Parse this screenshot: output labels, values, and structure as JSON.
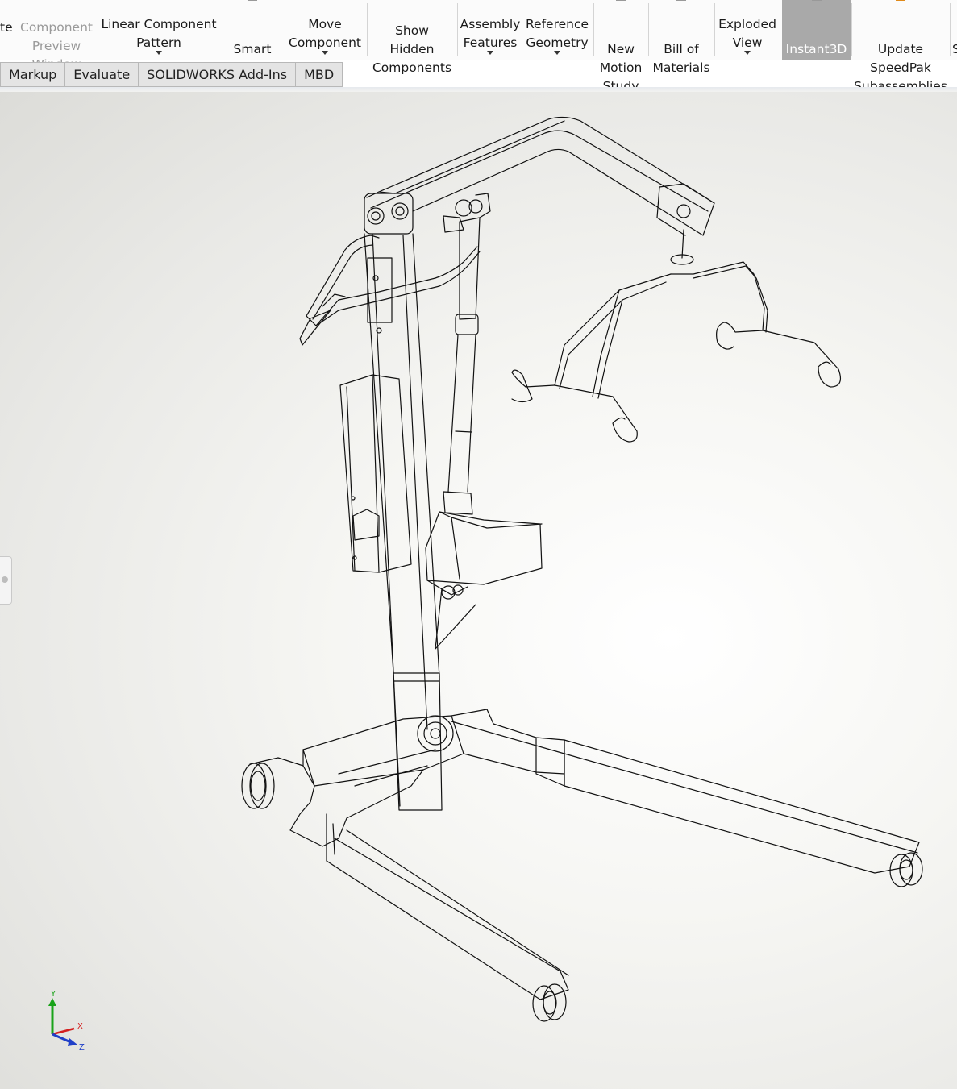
{
  "ribbon": {
    "buttons": [
      {
        "id": "paste",
        "label": "te",
        "disabled": false
      },
      {
        "id": "component-preview",
        "label": "Component\nPreview\nWindow",
        "disabled": true
      },
      {
        "id": "linear-pattern",
        "label": "Linear Component\nPattern",
        "dropdown": true
      },
      {
        "id": "smart-fasteners",
        "label": "Smart\nFasteners"
      },
      {
        "id": "move-component",
        "label": "Move\nComponent",
        "dropdown": true
      },
      {
        "id": "show-hidden",
        "label": "Show\nHidden\nComponents"
      },
      {
        "id": "assembly-features",
        "label": "Assembly\nFeatures",
        "dropdown": true
      },
      {
        "id": "reference-geometry",
        "label": "Reference\nGeometry",
        "dropdown": true
      },
      {
        "id": "new-motion-study",
        "label": "New\nMotion\nStudy"
      },
      {
        "id": "bill-of-materials",
        "label": "Bill of\nMaterials"
      },
      {
        "id": "exploded-view",
        "label": "Exploded\nView",
        "dropdown": true
      },
      {
        "id": "instant3d",
        "label": "Instant3D",
        "active": true
      },
      {
        "id": "update-speedpak",
        "label": "Update\nSpeedPak\nSubassemblies"
      }
    ],
    "overflow_glyph": "S"
  },
  "tabs": [
    "Markup",
    "Evaluate",
    "SOLIDWORKS Add-Ins",
    "MBD"
  ],
  "heads_up_toolbar": [
    "zoom-to-fit-icon",
    "zoom-to-area-icon",
    "previous-view-icon",
    "section-view-icon",
    "view-orientation-icon",
    "display-style-icon"
  ],
  "triad": {
    "y": "Y",
    "x": "X",
    "z": "Z"
  },
  "colors": {
    "active_button": "#a9a9a9",
    "wireframe": "#111111",
    "triad_y": "#1aa31a",
    "triad_x": "#d42020",
    "triad_z": "#2040c8"
  }
}
